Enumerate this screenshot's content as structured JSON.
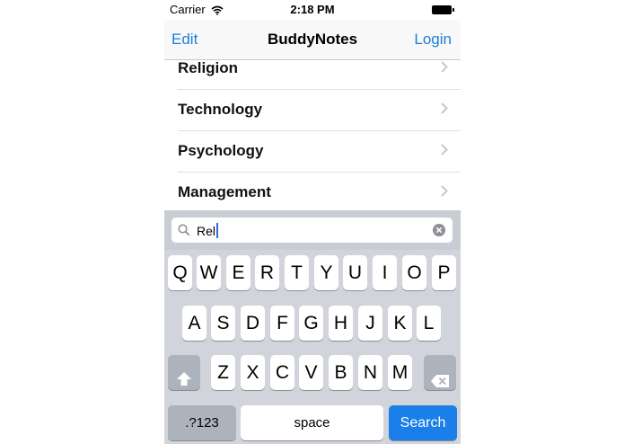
{
  "status_bar": {
    "carrier": "Carrier",
    "time": "2:18 PM"
  },
  "nav": {
    "left": "Edit",
    "title": "BuddyNotes",
    "right": "Login"
  },
  "list": {
    "items": [
      "Religion",
      "Technology",
      "Psychology",
      "Management"
    ]
  },
  "search": {
    "value": "Rel"
  },
  "keyboard": {
    "row1": [
      "Q",
      "W",
      "E",
      "R",
      "T",
      "Y",
      "U",
      "I",
      "O",
      "P"
    ],
    "row2": [
      "A",
      "S",
      "D",
      "F",
      "G",
      "H",
      "J",
      "K",
      "L"
    ],
    "row3": [
      "Z",
      "X",
      "C",
      "V",
      "B",
      "N",
      "M"
    ],
    "numbers_label": ".?123",
    "space_label": "space",
    "search_label": "Search"
  },
  "colors": {
    "accent": "#1a7fd8",
    "search_key": "#1a7fe8",
    "keyboard_bg": "#d1d4da"
  },
  "icons": [
    "wifi-icon",
    "battery-icon",
    "chevron-right-icon",
    "magnifier-icon",
    "clear-icon",
    "shift-icon",
    "backspace-icon"
  ]
}
